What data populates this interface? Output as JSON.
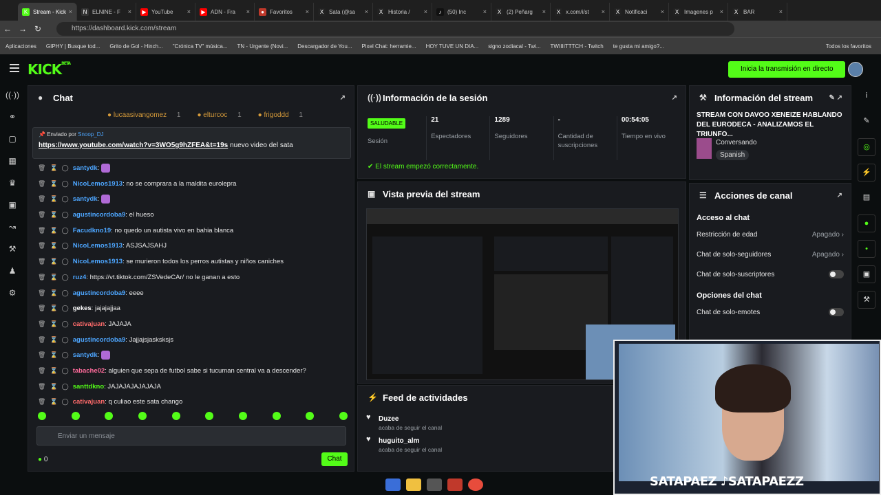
{
  "tabs": [
    {
      "label": "Stream - Kick",
      "color": "#53fc18",
      "icon": "K"
    },
    {
      "label": "ELNINE - F",
      "color": "#333333",
      "icon": "N"
    },
    {
      "label": "YouTube",
      "color": "#ff0000",
      "icon": "▶"
    },
    {
      "label": "ADN - Fra",
      "color": "#ff0000",
      "icon": "▶"
    },
    {
      "label": "Favoritos",
      "color": "#c0392b",
      "icon": "●"
    },
    {
      "label": "Sata (@sa",
      "color": "#222222",
      "icon": "X"
    },
    {
      "label": "Historia /",
      "color": "#222222",
      "icon": "X"
    },
    {
      "label": "(50) Inc",
      "color": "#111111",
      "icon": "♪"
    },
    {
      "label": "(2) Peñarg",
      "color": "#222222",
      "icon": "X"
    },
    {
      "label": "x.com/i/st",
      "color": "#222222",
      "icon": "X"
    },
    {
      "label": "Notificaci",
      "color": "#222222",
      "icon": "X"
    },
    {
      "label": "Imagenes p",
      "color": "#222222",
      "icon": "X"
    },
    {
      "label": "BAR",
      "color": "#222222",
      "icon": "X"
    }
  ],
  "address": {
    "url": "https://dashboard.kick.com/stream"
  },
  "bookmarks": [
    "Aplicaciones",
    "GIPHY | Busque tod...",
    "Grito de Gol - Hinch...",
    "\"Crónica TV\" música...",
    "TN - Urgente (Novi...",
    "Descargador de You...",
    "Pixel Chat: herramie...",
    "HOY TUVE UN DIA...",
    "signo zodiacal - Twi...",
    "TWIIIITTTCH - Twitch",
    "te gusta mi amigo?...",
    "Todos los favoritos"
  ],
  "header": {
    "logo": "KICK",
    "beta": "BETA",
    "go_live": "Inicia la transmisión en directo"
  },
  "chat": {
    "title": "Chat",
    "top": [
      {
        "name": "lucaasivangomez",
        "n": "1"
      },
      {
        "name": "elturcoc",
        "n": "1"
      },
      {
        "name": "frigoddd",
        "n": "1"
      }
    ],
    "pinned_by": "Enviado por",
    "pinned_user": "Snoop_DJ",
    "pinned_link": "https://www.youtube.com/watch?v=3WO5g9hZFEA&t=19s",
    "pinned_text": " nuevo video del sata",
    "messages": [
      {
        "user": "santydk",
        "color": "#4da6ff",
        "text": ""
      },
      {
        "user": "NicoLemos1913",
        "color": "#4da6ff",
        "text": "no se comprara a la maldita eurolepra"
      },
      {
        "user": "santydk",
        "color": "#4da6ff",
        "text": ""
      },
      {
        "user": "agustincordoba9",
        "color": "#4da6ff",
        "text": "el hueso"
      },
      {
        "user": "Facudkno19",
        "color": "#4da6ff",
        "text": "no quedo un autista vivo en bahia blanca"
      },
      {
        "user": "NicoLemos1913",
        "color": "#4da6ff",
        "text": "ASJSAJSAHJ"
      },
      {
        "user": "NicoLemos1913",
        "color": "#4da6ff",
        "text": "se murieron todos los perros autistas y niños caniches"
      },
      {
        "user": "ruz4",
        "color": "#4da6ff",
        "text": "https://vt.tiktok.com/ZSVedeCAr/ no le ganan a esto"
      },
      {
        "user": "agustincordoba9",
        "color": "#4da6ff",
        "text": "eeee"
      },
      {
        "user": "gekes",
        "color": "#ffffff",
        "text": "jajajajjaa"
      },
      {
        "user": "cativajuan",
        "color": "#ff6b6b",
        "text": "JAJAJA"
      },
      {
        "user": "agustincordoba9",
        "color": "#4da6ff",
        "text": "Jajjajsjasksksjs"
      },
      {
        "user": "santydk",
        "color": "#4da6ff",
        "text": ""
      },
      {
        "user": "tabache02",
        "color": "#ff6b9b",
        "text": "alguien que sepa de futbol sabe si tucuman central va a descender?"
      },
      {
        "user": "santtdkno",
        "color": "#53fc18",
        "text": "JAJAJAJAJAJAJA"
      },
      {
        "user": "cativajuan",
        "color": "#ff6b6b",
        "text": "q culiao este sata chango"
      }
    ],
    "input_placeholder": "Enviar un mensaje",
    "points": "0",
    "send": "Chat"
  },
  "session": {
    "title": "Información de la sesión",
    "status": "SALUDABLE",
    "status_label": "Sesión",
    "stats": [
      {
        "value": "21",
        "label": "Espectadores"
      },
      {
        "value": "1289",
        "label": "Seguidores"
      },
      {
        "value": "-",
        "label": "Cantidad de suscripciones"
      },
      {
        "value": "00:54:05",
        "label": "Tiempo en vivo"
      }
    ],
    "ok": "El stream empezó correctamente."
  },
  "preview": {
    "title": "Vista previa del stream"
  },
  "feed": {
    "title": "Feed de actividades",
    "items": [
      {
        "user": "Duzee",
        "action": "acaba de seguir el canal"
      },
      {
        "user": "huguito_alm",
        "action": "acaba de seguir el canal"
      }
    ]
  },
  "stream_info": {
    "title": "Información del stream",
    "stream_title": "STREAM CON DAVOO XENEIZE HABLANDO DEL EURODECA - ANALIZAMOS EL TRIUNFO...",
    "category": "Conversando",
    "language": "Spanish"
  },
  "actions": {
    "title": "Acciones de canal",
    "access": "Acceso al chat",
    "rows": [
      {
        "label": "Restricción de edad",
        "value": "Apagado"
      },
      {
        "label": "Chat de solo-seguidores",
        "value": "Apagado"
      }
    ],
    "subs_only": "Chat de solo-suscriptores",
    "options": "Opciones del chat",
    "emotes_only": "Chat de solo-emotes"
  },
  "overlay": {
    "social": "SATAPAEZ",
    "social2": "SATAPAEZZ"
  }
}
